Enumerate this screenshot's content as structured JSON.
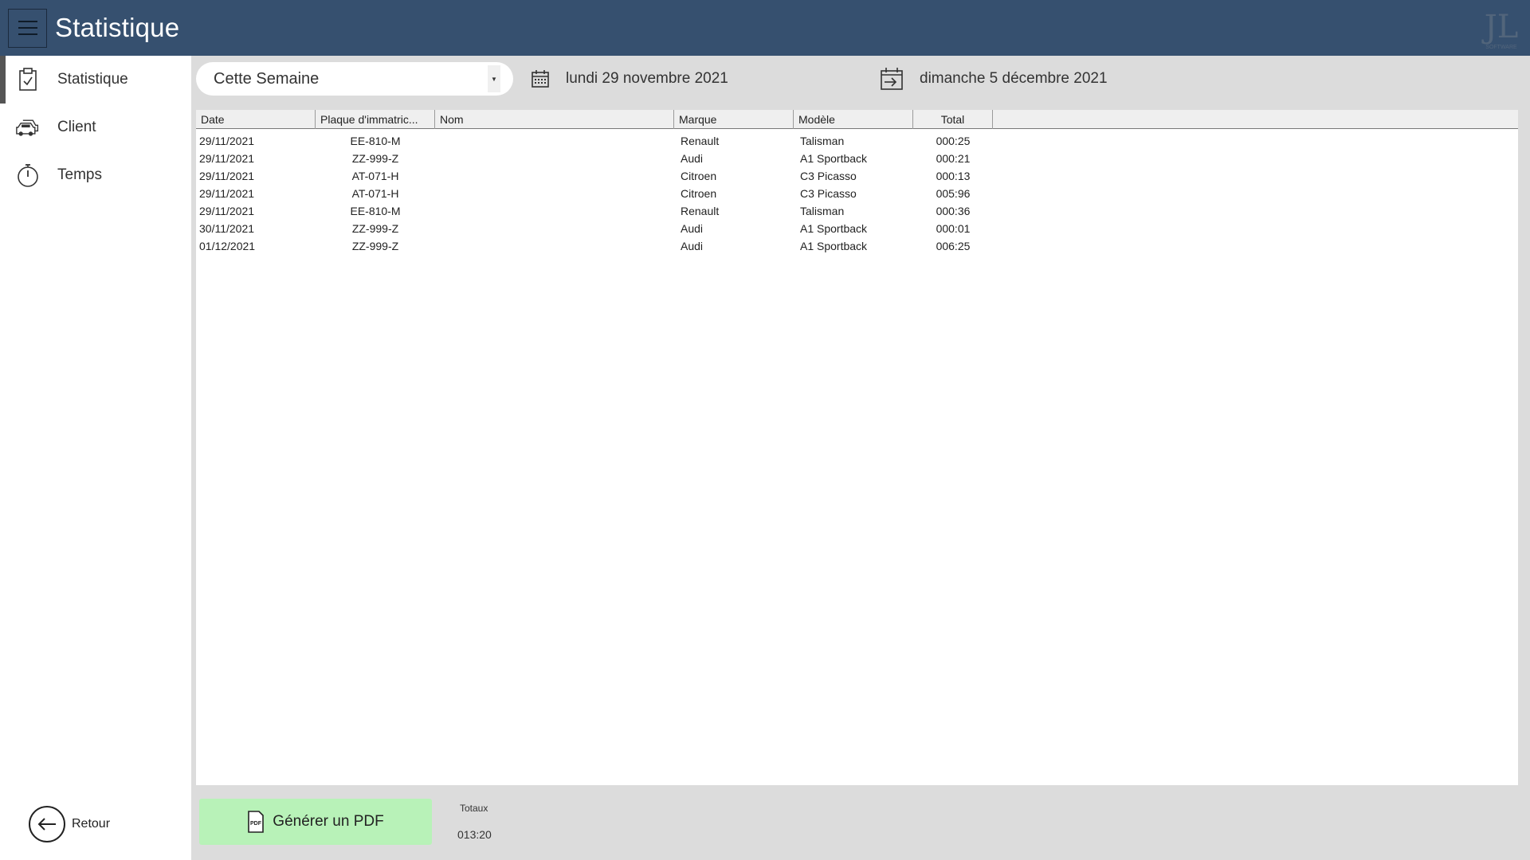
{
  "app": {
    "title": "Statistique",
    "logo_text": "JL",
    "logo_subtext": "SOFTWARE"
  },
  "sidebar": {
    "items": [
      {
        "label": "Statistique",
        "icon": "clipboard-check-icon",
        "active": true
      },
      {
        "label": "Client",
        "icon": "cars-icon",
        "active": false
      },
      {
        "label": "Temps",
        "icon": "stopwatch-icon",
        "active": false
      }
    ],
    "back_label": "Retour"
  },
  "toolbar": {
    "period": "Cette Semaine",
    "start_date": "lundi 29 novembre 2021",
    "end_date": "dimanche 5 décembre 2021"
  },
  "table": {
    "columns": [
      "Date",
      "Plaque d'immatric...",
      "Nom",
      "Marque",
      "Modèle",
      "Total"
    ],
    "rows": [
      [
        "29/11/2021",
        "EE-810-M",
        "",
        "Renault",
        "Talisman",
        "000:25"
      ],
      [
        "29/11/2021",
        "ZZ-999-Z",
        "",
        "Audi",
        "A1 Sportback",
        "000:21"
      ],
      [
        "29/11/2021",
        "AT-071-H",
        "",
        "Citroen",
        "C3 Picasso",
        "000:13"
      ],
      [
        "29/11/2021",
        "AT-071-H",
        "",
        "Citroen",
        "C3 Picasso",
        "005:96"
      ],
      [
        "29/11/2021",
        "EE-810-M",
        "",
        "Renault",
        "Talisman",
        "000:36"
      ],
      [
        "30/11/2021",
        "ZZ-999-Z",
        "",
        "Audi",
        "A1 Sportback",
        "000:01"
      ],
      [
        "01/12/2021",
        "ZZ-999-Z",
        "",
        "Audi",
        "A1 Sportback",
        "006:25"
      ]
    ]
  },
  "footer": {
    "pdf_button_label": "Générer un PDF",
    "pdf_icon_text": "PDF",
    "totaux_label": "Totaux",
    "totaux_value": "013:20"
  },
  "colors": {
    "titlebar": "#36506f",
    "content_bg": "#dcdcdc",
    "pdf_button": "#b8f2b8"
  }
}
